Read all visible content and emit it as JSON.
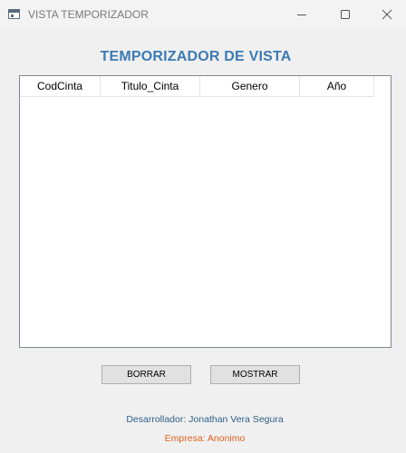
{
  "window": {
    "title": "VISTA TEMPORIZADOR",
    "icon": "app-window-icon",
    "controls": [
      "minimize-icon",
      "maximize-icon",
      "close-icon"
    ]
  },
  "header": {
    "title": "TEMPORIZADOR DE VISTA",
    "color": "#3c7ab4"
  },
  "table": {
    "columns": [
      "CodCinta",
      "Titulo_Cinta",
      "Genero",
      "Año"
    ],
    "rows": []
  },
  "buttons": {
    "borrar": "BORRAR",
    "mostrar": "MOSTRAR"
  },
  "footer": {
    "developer": "Desarrollador: Jonathan Vera Segura",
    "developer_color": "#2e5f88",
    "company": "Empresa: Anonimo",
    "company_color": "#e0601a"
  }
}
